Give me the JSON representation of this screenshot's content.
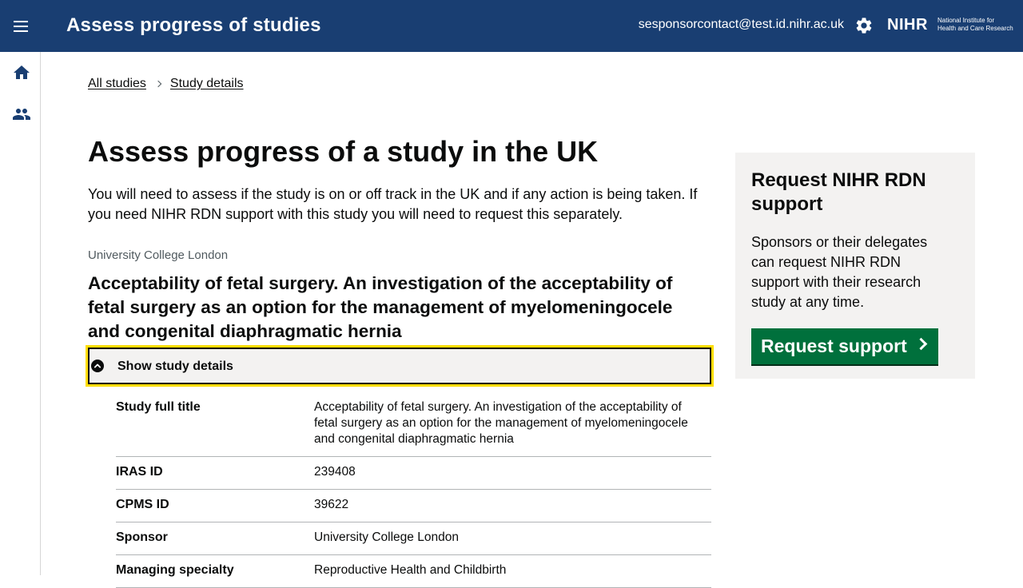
{
  "header": {
    "title": "Assess progress of studies",
    "user_email": "sesponsorcontact@test.id.nihr.ac.uk",
    "logo_mark": "NIHR",
    "logo_text_line1": "National Institute for",
    "logo_text_line2": "Health and Care Research",
    "bg_color": "#193e72"
  },
  "sidebar": {
    "icons": [
      "home-icon",
      "people-icon"
    ]
  },
  "breadcrumb": {
    "items": [
      "All studies",
      "Study details"
    ]
  },
  "main": {
    "title": "Assess progress of a study in the UK",
    "intro": "You will need to assess if the study is on or off track in the UK and if any action is being taken. If you need NIHR RDN support with this study you will need to request this separately.",
    "organisation": "University College London",
    "study_title": "Acceptability of fetal surgery. An investigation of the acceptability of fetal surgery as an option for the management of myelomeningocele and congenital diaphragmatic hernia",
    "details_toggle_label": "Show study details",
    "details": [
      {
        "key": "Study full title",
        "value": "Acceptability of fetal surgery. An investigation of the acceptability of fetal surgery as an option for the management of myelomeningocele and congenital diaphragmatic hernia"
      },
      {
        "key": "IRAS ID",
        "value": "239408"
      },
      {
        "key": "CPMS ID",
        "value": "39622"
      },
      {
        "key": "Sponsor",
        "value": "University College London"
      },
      {
        "key": "Managing specialty",
        "value": "Reproductive Health and Childbirth"
      }
    ]
  },
  "aside": {
    "title": "Request NIHR RDN support",
    "body": "Sponsors or their delegates can request NIHR RDN support with their research study at any time.",
    "button_label": "Request support",
    "button_color": "#00703c"
  },
  "colors": {
    "focus": "#ffdd00",
    "panel_bg": "#f3f2f1"
  }
}
